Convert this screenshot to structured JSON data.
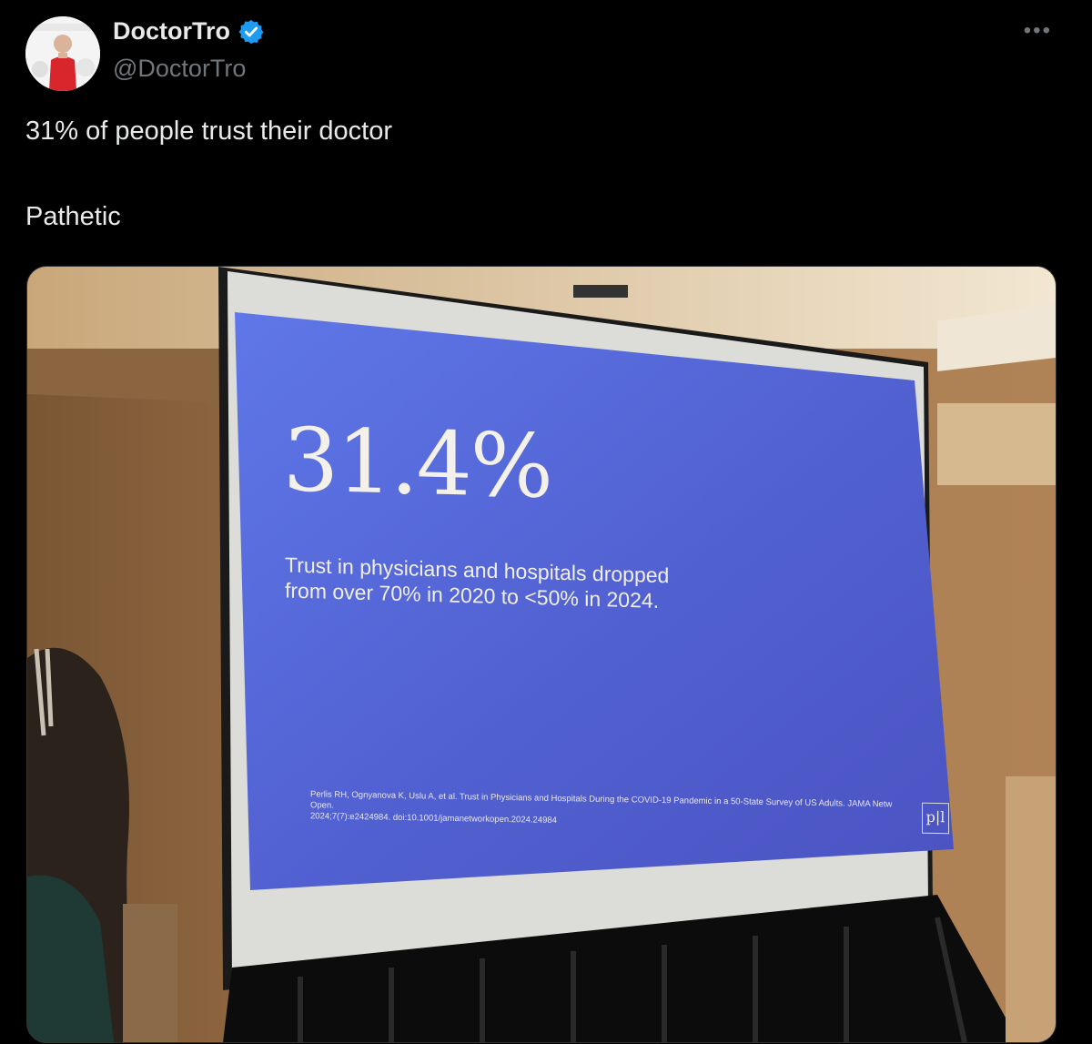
{
  "author": {
    "display_name": "DoctorTro",
    "handle": "@DoctorTro",
    "verified_icon": "verified-badge-icon",
    "verified_color": "#1d9bf0"
  },
  "menu": {
    "more_label": "•••"
  },
  "tweet": {
    "line1": "31% of people trust their doctor",
    "line2": "Pathetic"
  },
  "slide": {
    "big_number": "31.4%",
    "subtitle": "Trust in physicians and hospitals dropped from over 70% in 2020 to <50% in 2024.",
    "citation_line1": "Perlis RH, Ognyanova K, Uslu A, et al. Trust in Physicians and Hospitals During the COVID-19 Pandemic in a 50-State Survey of US Adults. JAMA Netw Open.",
    "citation_line2": "2024;7(7):e2424984. doi:10.1001/jamanetworkopen.2024.24984",
    "logo_text": "p|l",
    "background_color": "#5564d4"
  }
}
